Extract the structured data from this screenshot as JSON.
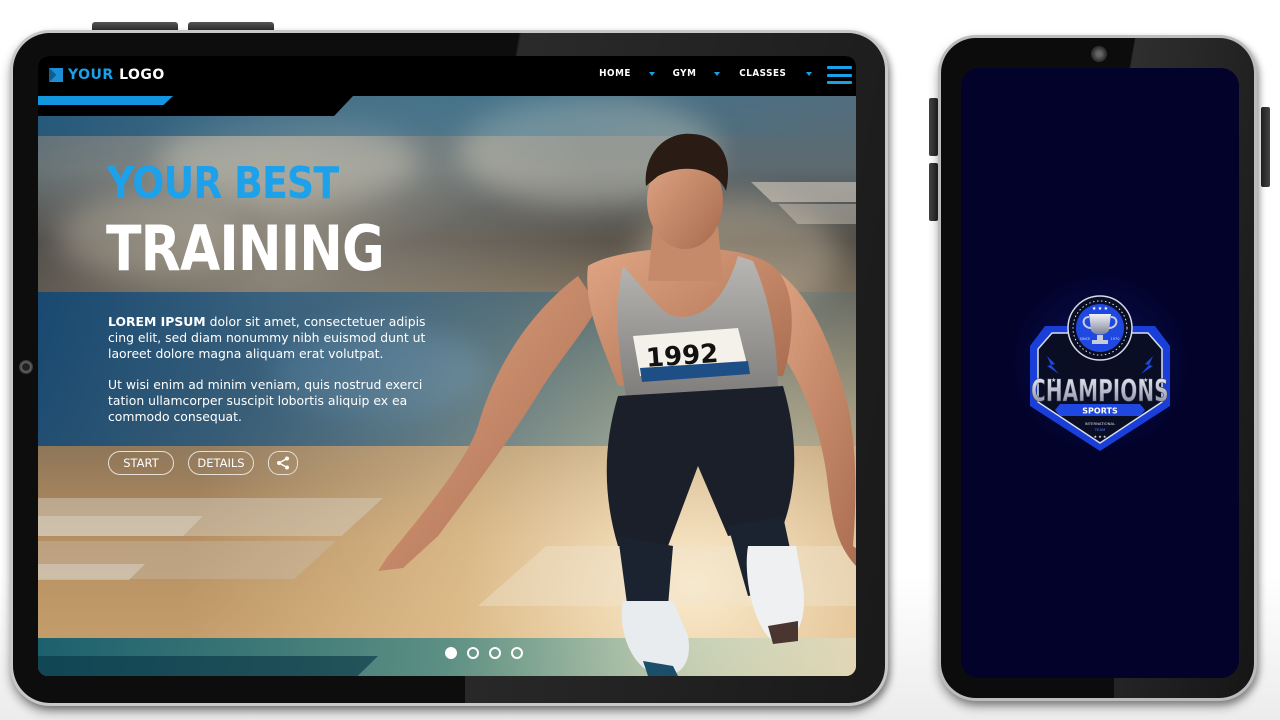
{
  "tablet": {
    "nav": {
      "logo": {
        "first": "YOUR",
        "second": "LOGO",
        "icon": "logo-mark-icon"
      },
      "items": [
        {
          "label": "HOME",
          "icon": "caret-down-icon"
        },
        {
          "label": "GYM",
          "icon": "caret-down-icon"
        },
        {
          "label": "CLASSES",
          "icon": "caret-down-icon"
        }
      ],
      "menu_icon": "hamburger-menu-icon"
    },
    "hero": {
      "title_line1": "YOUR BEST",
      "title_line2": "TRAINING",
      "paragraph1_bold": "LOREM IPSUM",
      "paragraph1": " dolor sit amet, consectetuer adipis cing elit, sed diam nonummy nibh euismod dunt ut laoreet dolore magna aliquam erat volutpat.",
      "paragraph2": "Ut wisi enim ad minim veniam, quis nostrud exerci tation ullamcorper suscipit lobortis aliquip ex ea commodo consequat.",
      "buttons": {
        "start": "START",
        "details": "DETAILS",
        "share_icon": "share-icon"
      },
      "bib_number": "1992"
    },
    "carousel": {
      "total": 4,
      "active_index": 0
    }
  },
  "phone": {
    "badge": {
      "title": "CHAMPIONS",
      "ribbon": "SPORTS",
      "sub1": "INTERNATIONAL",
      "sub2": "TEAM",
      "since": "SINCE",
      "year": "1970",
      "icon": "trophy-icon"
    }
  },
  "colors": {
    "accent_blue": "#1da1ea",
    "phone_screen": "#02022a",
    "badge_blue": "#1a3fd9"
  }
}
